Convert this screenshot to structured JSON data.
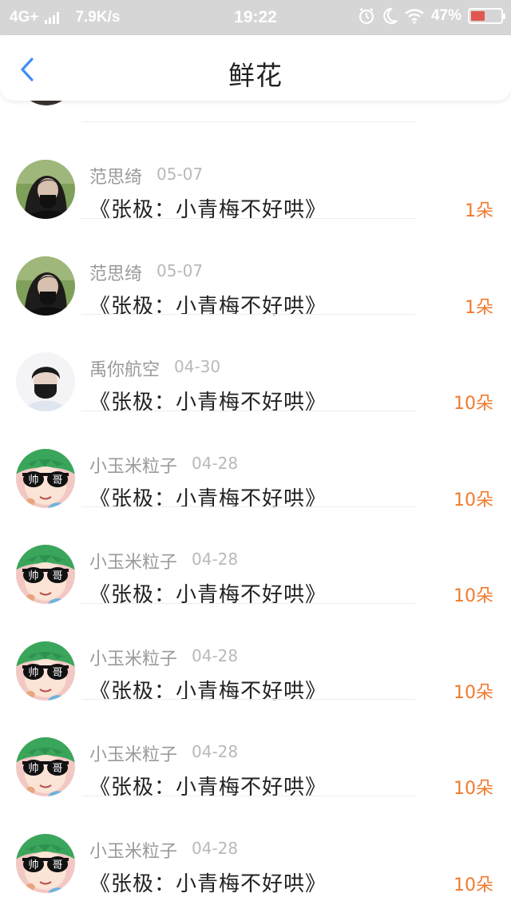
{
  "status_bar": {
    "network": "4G+",
    "speed": "7.9K/s",
    "time": "19:22",
    "battery": "47%",
    "battery_level": 0.47
  },
  "header": {
    "title": "鲜花"
  },
  "colors": {
    "accent": "#3e8ef7",
    "count": "#f07a2e",
    "status_bar_bg": "#d6d6d6"
  },
  "records": [
    {
      "name": "范思绮",
      "date": "05-07",
      "book": "《张极：小青梅不好哄》",
      "count": "1朵",
      "avatar": "girl-dark-hair-avatar"
    },
    {
      "name": "范思绮",
      "date": "05-07",
      "book": "《张极：小青梅不好哄》",
      "count": "1朵",
      "avatar": "girl-dark-hair-avatar"
    },
    {
      "name": "禹你航空",
      "date": "04-30",
      "book": "《张极：小青梅不好哄》",
      "count": "10朵",
      "avatar": "masked-boy-avatar"
    },
    {
      "name": "小玉米粒子",
      "date": "04-28",
      "book": "《张极：小青梅不好哄》",
      "count": "10朵",
      "avatar": "cartoon-sunglasses-avatar",
      "glasses": [
        "帅",
        "哥"
      ]
    },
    {
      "name": "小玉米粒子",
      "date": "04-28",
      "book": "《张极：小青梅不好哄》",
      "count": "10朵",
      "avatar": "cartoon-sunglasses-avatar",
      "glasses": [
        "帅",
        "哥"
      ]
    },
    {
      "name": "小玉米粒子",
      "date": "04-28",
      "book": "《张极：小青梅不好哄》",
      "count": "10朵",
      "avatar": "cartoon-sunglasses-avatar",
      "glasses": [
        "帅",
        "哥"
      ]
    },
    {
      "name": "小玉米粒子",
      "date": "04-28",
      "book": "《张极：小青梅不好哄》",
      "count": "10朵",
      "avatar": "cartoon-sunglasses-avatar",
      "glasses": [
        "帅",
        "哥"
      ]
    },
    {
      "name": "小玉米粒子",
      "date": "04-28",
      "book": "《张极：小青梅不好哄》",
      "count": "10朵",
      "avatar": "cartoon-sunglasses-avatar",
      "glasses": [
        "帅",
        "哥"
      ]
    }
  ]
}
